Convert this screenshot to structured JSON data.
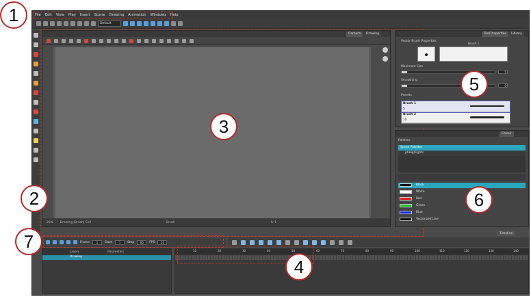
{
  "menu": [
    "File",
    "Edit",
    "View",
    "Play",
    "Insert",
    "Scene",
    "Drawing",
    "Animation",
    "Windows",
    "Help"
  ],
  "toolbar": {
    "preset": "Default"
  },
  "view_tabs": {
    "camera": "Camera",
    "drawing": "Drawing"
  },
  "camera_status": {
    "zoom": "20%",
    "mode": "Drawing (Brush) Cell",
    "tool": "Brush",
    "frame": "Fr 1"
  },
  "tool_properties": {
    "tabs": {
      "tool": "Tool Properties",
      "library": "Library"
    },
    "title": "Vector Brush Properties",
    "brush_name": "Brush 1",
    "max_size_label": "Maximum Size",
    "max_size_value": "5",
    "smoothing_label": "Smoothing",
    "smoothing_value": "0",
    "presets_label": "Presets",
    "brushes": [
      {
        "name": "Brush 1",
        "size": "5"
      },
      {
        "name": "Brush 2",
        "size": "10"
      }
    ]
  },
  "colour": {
    "tab": "Colour",
    "palettes_label": "Palettes",
    "scene_palettes": "Scene Palettes",
    "palette_item": "phHighlights",
    "swatches": [
      {
        "name": "Black",
        "color": "#000000"
      },
      {
        "name": "White",
        "color": "#ffffff"
      },
      {
        "name": "Red",
        "color": "#e02020"
      },
      {
        "name": "Green",
        "color": "#20c020"
      },
      {
        "name": "Blue",
        "color": "#1020e0"
      },
      {
        "name": "Vectorized Line",
        "color": "#000000"
      }
    ]
  },
  "playback": {
    "frame_label": "Frame",
    "frame_value": "1",
    "start_label": "Start",
    "start_value": "1",
    "stop_label": "Stop",
    "stop_value": "60",
    "fps_label": "FPS",
    "fps_value": "24"
  },
  "timeline": {
    "tab": "Timeline",
    "layers_header": "Layers",
    "params_header": "Parameters",
    "layer_name": "Drawing",
    "ruler": [
      "10",
      "20",
      "30",
      "40",
      "50",
      "60",
      "70",
      "80",
      "90",
      "100",
      "110",
      "120",
      "130",
      "140"
    ]
  },
  "callouts": [
    "1",
    "2",
    "3",
    "4",
    "5",
    "6",
    "7"
  ],
  "colors": {
    "accent": "#2aa7bf",
    "callout_border": "#b52a2a",
    "outline": "#c0392b"
  }
}
